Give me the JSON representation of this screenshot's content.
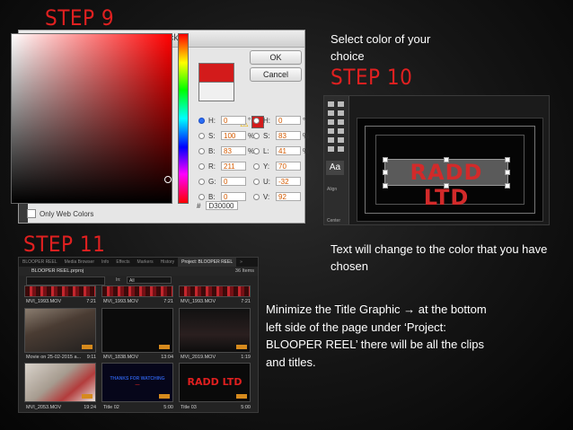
{
  "step9": {
    "title": "STEP 9"
  },
  "step10": {
    "title": "STEP 10",
    "caption": "Select color of your choice"
  },
  "step11": {
    "title": "STEP 11",
    "caption_top": "Text will change to the color that you have chosen",
    "caption_bottom": "Minimize the Title Graphic → at the bottom left side of the page under ‘Project: BLOOPER REEL’ there will be all the clips and titles."
  },
  "color_picker": {
    "window_title": "Color Picker",
    "ok_label": "OK",
    "cancel_label": "Cancel",
    "only_web_colors_label": "Only Web Colors",
    "selected_color": "#d31b1b",
    "hue_color": "#ff0000",
    "warning_icon": "warning-triangle-icon",
    "fields_left": [
      {
        "label": "H:",
        "value": "0",
        "unit": "°",
        "selected": true
      },
      {
        "label": "S:",
        "value": "100",
        "unit": "%"
      },
      {
        "label": "B:",
        "value": "83",
        "unit": "%"
      },
      {
        "label": "R:",
        "value": "211",
        "unit": ""
      },
      {
        "label": "G:",
        "value": "0",
        "unit": ""
      },
      {
        "label": "B:",
        "value": "0",
        "unit": ""
      }
    ],
    "fields_right": [
      {
        "label": "H:",
        "value": "0",
        "unit": "°"
      },
      {
        "label": "S:",
        "value": "83",
        "unit": "%"
      },
      {
        "label": "L:",
        "value": "41",
        "unit": "%"
      },
      {
        "label": "Y:",
        "value": "70",
        "unit": ""
      },
      {
        "label": "U:",
        "value": "-32",
        "unit": ""
      },
      {
        "label": "V:",
        "value": "92",
        "unit": ""
      }
    ],
    "hex_label": "#",
    "hex_value": "D30000"
  },
  "title_editor": {
    "aa_label": "Aa",
    "align_label": "Align",
    "center_label": "Center",
    "title_text": "RADD LTD",
    "text_color": "#d22a2a"
  },
  "project_panel": {
    "tabs": [
      "BLOOPER REEL",
      "Media Browser",
      "Info",
      "Effects",
      "Markers",
      "History",
      "Project: BLOOPER REEL",
      "»"
    ],
    "active_tab": 6,
    "project_name": "BLOOPER REEL.prproj",
    "item_count": "36 Items",
    "in_label": "In:",
    "in_value": "All",
    "row1": [
      {
        "name": "MVI_1993.MOV",
        "duration": "7:21"
      },
      {
        "name": "MVI_1993.MOV",
        "duration": "7:21"
      },
      {
        "name": "MVI_1993.MOV",
        "duration": "7:21"
      }
    ],
    "row2": [
      {
        "name": "Movie on 25-02-2015 a...",
        "duration": "9:11"
      },
      {
        "name": "MVI_1838.MOV",
        "duration": "13:04"
      },
      {
        "name": "MVI_2019.MOV",
        "duration": "1:19"
      }
    ],
    "row3": [
      {
        "name": "MVI_2053.MOV",
        "duration": "19:24"
      },
      {
        "name": "Title 02",
        "duration": "5:00"
      },
      {
        "name": "Title 03",
        "duration": "5:00"
      }
    ],
    "thank_you_text": "THANKS FOR WATCHING",
    "thank_sub": "—",
    "radd_thumb_text": "RADD LTD"
  }
}
